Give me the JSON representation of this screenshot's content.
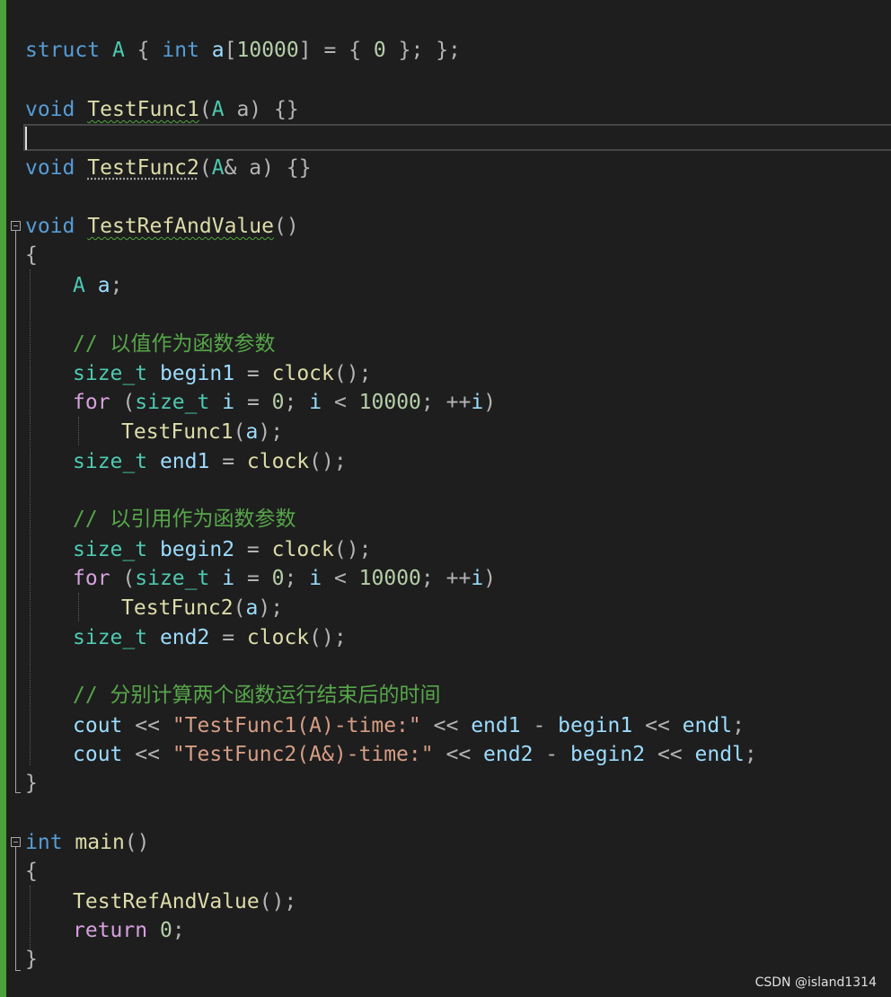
{
  "code": {
    "l_struct": "struct A { int a[10000] = { 0 }; };",
    "kw_struct": "struct",
    "ty_A1": "A",
    "kw_int1": "int",
    "kw_void1": "void",
    "fn_TestFunc1": "TestFunc1",
    "kw_void2": "void",
    "fn_TestFunc2": "TestFunc2",
    "kw_void3": "void",
    "fn_TestRefAndValue": "TestRefAndValue",
    "decl_a": "a",
    "comment1": "// 以值作为函数参数",
    "comment2": "// 以引用作为函数参数",
    "comment3": "// 分别计算两个函数运行结束后的时间",
    "ty_size_t": "size_t",
    "var_begin1": "begin1",
    "var_end1": "end1",
    "var_begin2": "begin2",
    "var_end2": "end2",
    "fn_clock": "clock",
    "kw_for": "for",
    "var_i": "i",
    "num_0": "0",
    "num_10000": "10000",
    "var_cout": "cout",
    "str1": "\"TestFunc1(A)-time:\"",
    "str2": "\"TestFunc2(A&)-time:\"",
    "var_endl": "endl",
    "kw_int2": "int",
    "fn_main": "main",
    "kw_return": "return"
  },
  "watermark": "CSDN @island1314"
}
